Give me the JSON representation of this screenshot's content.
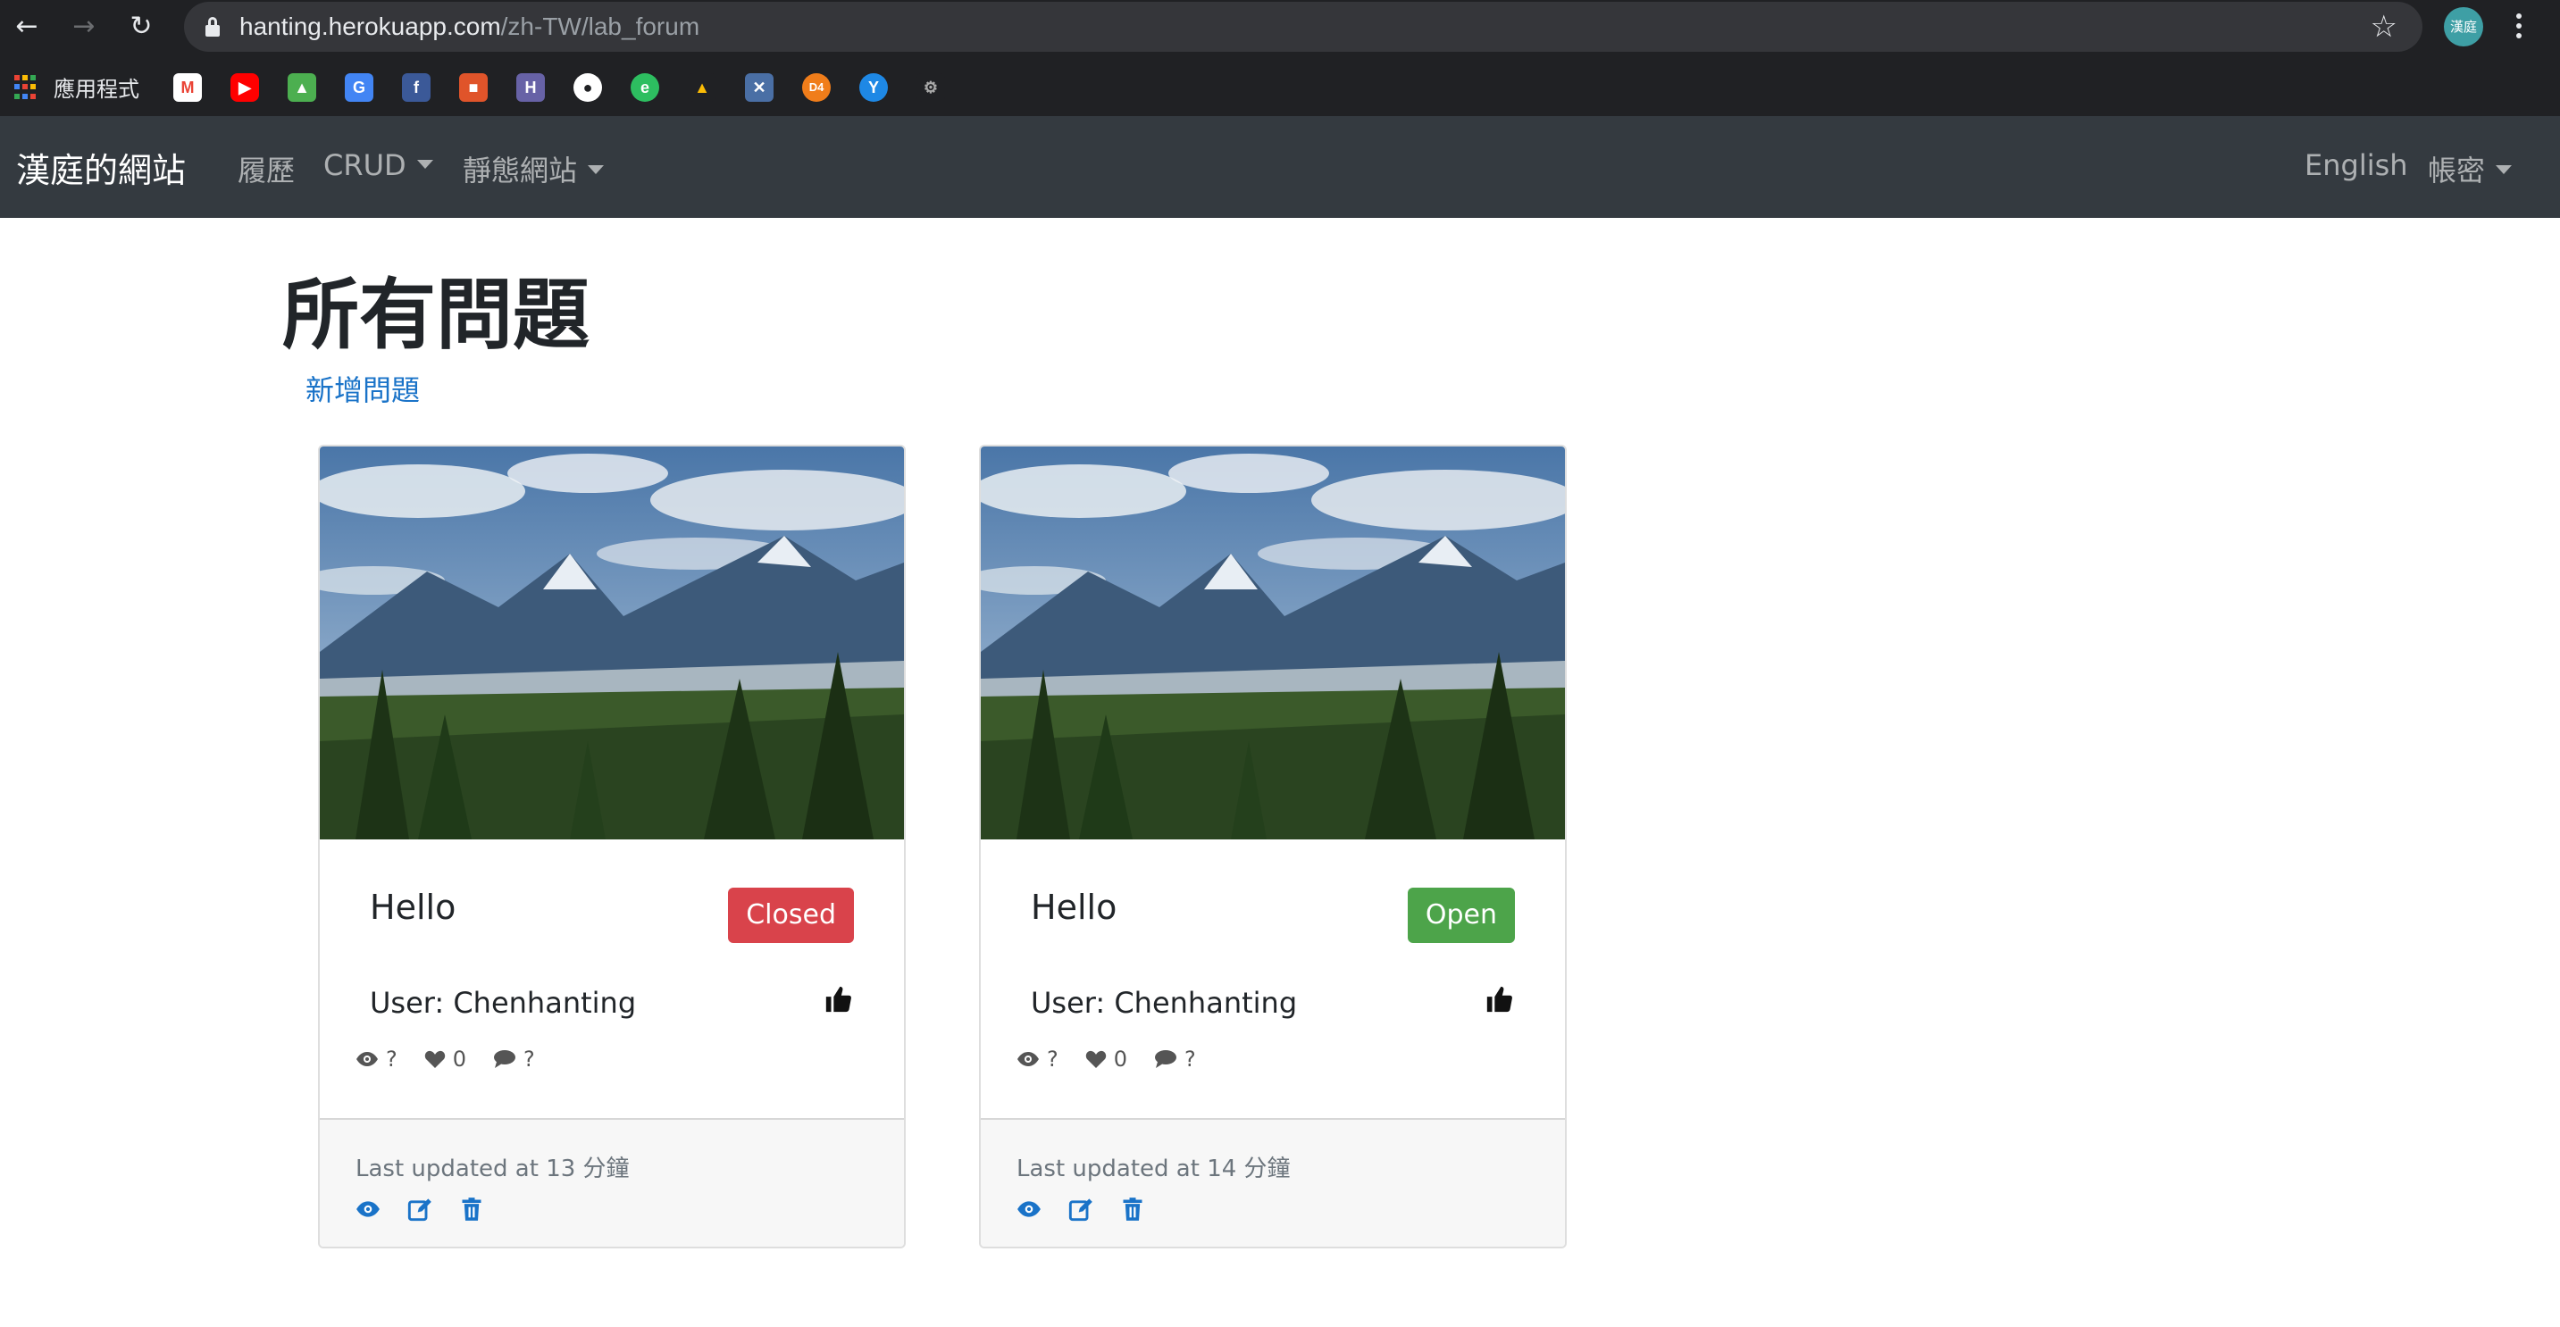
{
  "browser": {
    "url_host": "hanting.herokuapp.com",
    "url_path": "/zh-TW/lab_forum",
    "profile_label": "漢庭",
    "apps_label": "應用程式",
    "bookmark_icons": [
      "gmail-icon",
      "youtube-icon",
      "maps-icon",
      "translate-icon",
      "facebook-icon",
      "shop-icon",
      "heroku-icon",
      "globe-icon",
      "evernote-icon",
      "drive-icon",
      "xmind-icon",
      "d4-icon",
      "yoda-icon",
      "settings-icon"
    ]
  },
  "navbar": {
    "brand": "漢庭的網站",
    "links": [
      "履歷",
      "CRUD",
      "靜態網站"
    ],
    "right_links": [
      "English",
      "帳密"
    ]
  },
  "page": {
    "title": "所有問題",
    "new_link": "新增問題"
  },
  "cards": [
    {
      "title": "Hello",
      "status": "Closed",
      "status_color": "#d9434b",
      "user": "User: Chenhanting",
      "views": "?",
      "likes": "0",
      "comments": "?",
      "updated": "Last updated at 13 分鐘"
    },
    {
      "title": "Hello",
      "status": "Open",
      "status_color": "#4da44a",
      "user": "User: Chenhanting",
      "views": "?",
      "likes": "0",
      "comments": "?",
      "updated": "Last updated at 14 分鐘"
    }
  ],
  "colors": {
    "navbar_bg": "#343a40",
    "link": "#1a73c8",
    "closed": "#d9434b",
    "open": "#4da44a"
  }
}
